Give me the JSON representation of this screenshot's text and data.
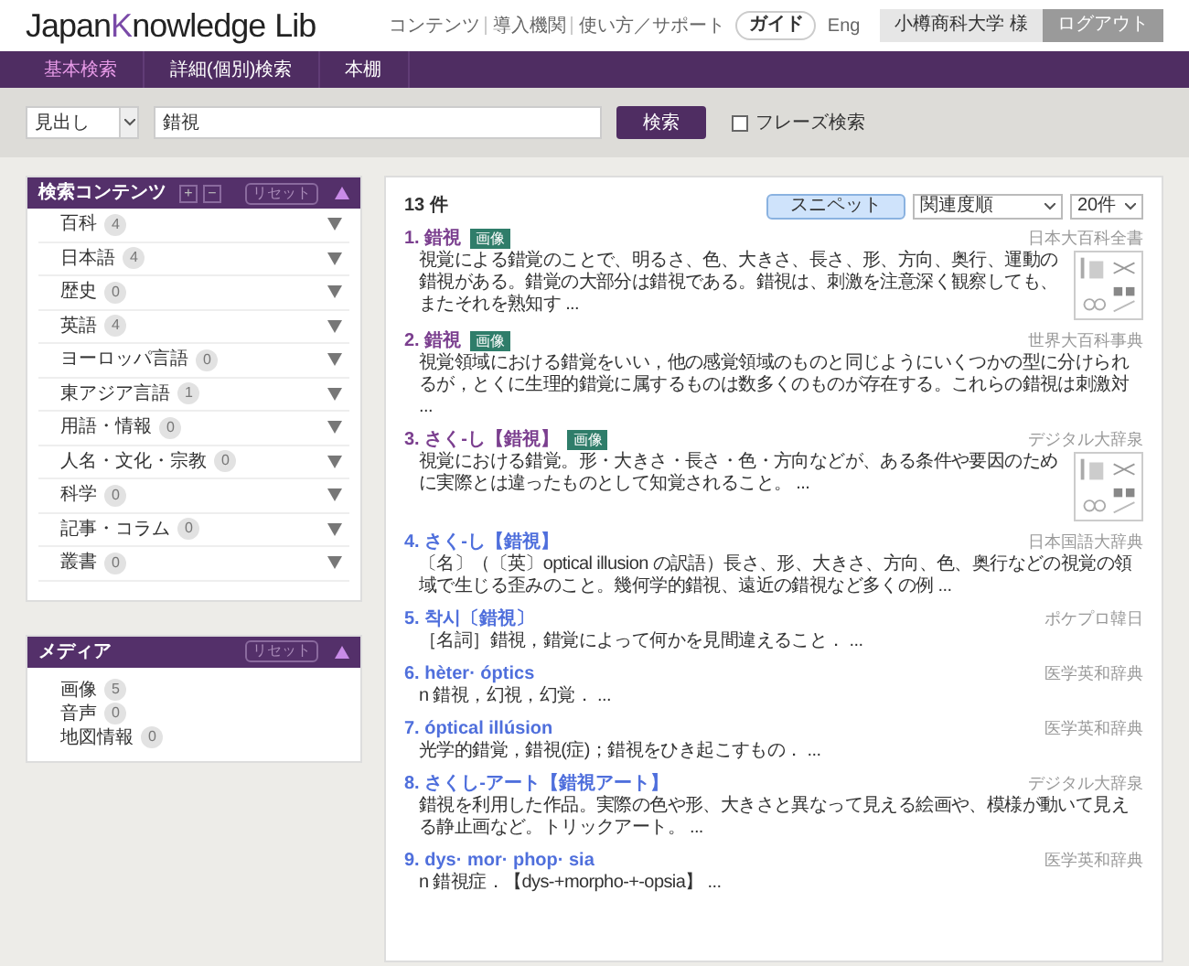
{
  "header": {
    "logo": {
      "before": "Japan",
      "accent": "K",
      "after": "nowledge",
      "suffix": "Lib"
    },
    "links": [
      {
        "label": "コンテンツ",
        "kind": "link"
      },
      {
        "label": "導入機関",
        "kind": "link"
      },
      {
        "label": "使い方／サポート",
        "kind": "link"
      },
      {
        "label": "ガイド",
        "kind": "pill"
      },
      {
        "label": "Eng",
        "kind": "link"
      }
    ],
    "user": "小樽商科大学 様",
    "logout": "ログアウト"
  },
  "nav": {
    "tabs": [
      {
        "label": "基本検索",
        "selected": true
      },
      {
        "label": "詳細(個別)検索",
        "selected": false
      },
      {
        "label": "本棚",
        "selected": false
      }
    ]
  },
  "search": {
    "scope": "見出し",
    "value": "錯視",
    "button": "検索",
    "phrase": {
      "label": "フレーズ検索",
      "checked": false
    }
  },
  "contents_panel": {
    "title": "検索コンテンツ",
    "plus": "+",
    "minus": "−",
    "reset": "リセット",
    "expanded": true,
    "items": [
      {
        "label": "百科",
        "count": "4"
      },
      {
        "label": "日本語",
        "count": "4"
      },
      {
        "label": "歴史",
        "count": "0"
      },
      {
        "label": "英語",
        "count": "4"
      },
      {
        "label": "ヨーロッパ言語",
        "count": "0"
      },
      {
        "label": "東アジア言語",
        "count": "1"
      },
      {
        "label": "用語・情報",
        "count": "0"
      },
      {
        "label": "人名・文化・宗教",
        "count": "0"
      },
      {
        "label": "科学",
        "count": "0"
      },
      {
        "label": "記事・コラム",
        "count": "0"
      },
      {
        "label": "叢書",
        "count": "0"
      }
    ]
  },
  "media_panel": {
    "title": "メディア",
    "reset": "リセット",
    "expanded": true,
    "items": [
      {
        "label": "画像",
        "count": "5"
      },
      {
        "label": "音声",
        "count": "0"
      },
      {
        "label": "地図情報",
        "count": "0"
      }
    ]
  },
  "results": {
    "count": "13 件",
    "snippet": {
      "label": "スニペット",
      "selected": true
    },
    "sort": "関連度順",
    "per_page": "20件",
    "items": [
      {
        "title": "1. 錯視",
        "visited": true,
        "badge": "画像",
        "source": "日本大百科全書",
        "snippet": "視覚による錯覚のことで、明るさ、色、大きさ、長さ、形、方向、奥行、運動の錯視がある。錯覚の大部分は錯視である。錯視は、刺激を注意深く観察しても、またそれを熟知す ..."
      },
      {
        "title": "2. 錯視",
        "visited": true,
        "badge": "画像",
        "source": "世界大百科事典",
        "snippet": "視覚領域における錯覚をいい，他の感覚領域のものと同じようにいくつかの型に分けられるが，とくに生理的錯覚に属するものは数多くのものが存在する。これらの錯視は刺激対 ..."
      },
      {
        "title": "3. さく‐し【錯視】",
        "visited": true,
        "badge": "画像",
        "source": "デジタル大辞泉",
        "snippet": "視覚における錯覚。形・大きさ・長さ・色・方向などが、ある条件や要因のために実際とは違ったものとして知覚されること。 ..."
      },
      {
        "title": "4. さく‐し【錯視】",
        "visited": false,
        "source": "日本国語大辞典",
        "snippet": "〔名〕（〔英〕optical illusion の訳語）長さ、形、大きさ、方向、色、奥行などの視覚の領域で生じる歪みのこと。幾何学的錯視、遠近の錯視など多くの例 ..."
      },
      {
        "title": "5. 착시〔錯視〕",
        "visited": false,
        "source": "ポケプロ韓日",
        "snippet": "［名詞］錯視，錯覚によって何かを見間違えること．  ..."
      },
      {
        "title": "6. hèter· óptics",
        "visited": false,
        "source": "医学英和辞典",
        "snippet": "n 錯視，幻視，幻覚．  ..."
      },
      {
        "title": "7. óptical illúsion",
        "visited": false,
        "source": "医学英和辞典",
        "snippet": "光学的錯覚，錯視(症)；錯視をひき起こすもの．  ..."
      },
      {
        "title": "8. さくし‐アート【錯視アート】",
        "visited": false,
        "source": "デジタル大辞泉",
        "snippet": "錯視を利用した作品。実際の色や形、大きさと異なって見える絵画や、模様が動いて見える静止画など。トリックアート。 ..."
      },
      {
        "title": "9. dys· mor· phop· sia",
        "visited": false,
        "source": "医学英和辞典",
        "snippet": "n 錯視症．【dys-+morpho-+-opsia】 ..."
      }
    ]
  }
}
